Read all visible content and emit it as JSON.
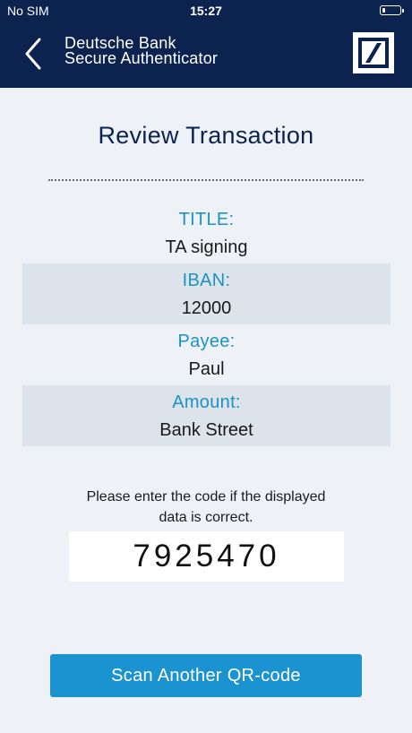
{
  "status_bar": {
    "carrier": "No SIM",
    "time": "15:27",
    "battery_icon": "battery-low-icon"
  },
  "nav": {
    "title_line1": "Deutsche Bank",
    "title_line2": "Secure Authenticator",
    "back_icon": "chevron-left-icon",
    "logo": "deutsche-bank-logo"
  },
  "screen": {
    "title": "Review Transaction",
    "fields": [
      {
        "label": "TITLE:",
        "value": "TA signing"
      },
      {
        "label": "IBAN:",
        "value": "12000"
      },
      {
        "label": "Payee:",
        "value": "Paul"
      },
      {
        "label": "Amount:",
        "value": "Bank Street"
      }
    ],
    "prompt_line1": "Please enter the code if the displayed",
    "prompt_line2": "data is correct.",
    "code": "7925470",
    "scan_button_label": "Scan Another QR-code"
  },
  "colors": {
    "navbar": "#0c2350",
    "accent": "#1a93c4",
    "button": "#1a93d0",
    "background": "#eef2f7",
    "row_alt": "#dde3ea"
  }
}
